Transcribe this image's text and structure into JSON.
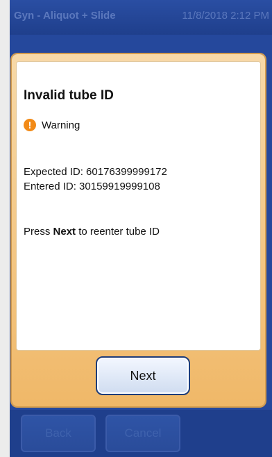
{
  "header": {
    "title": "Gyn - Aliquot + Slide",
    "datetime": "11/8/2018 2:12 PM"
  },
  "dialog": {
    "title": "Invalid tube ID",
    "severity_label": "Warning",
    "expected_label": "Expected ID: ",
    "expected_id": "60176399999172",
    "entered_label": "Entered ID: ",
    "entered_id": "30159919999108",
    "instruction_prefix": "Press ",
    "instruction_bold": "Next",
    "instruction_suffix": " to reenter tube ID",
    "next_label": "Next",
    "icon": "warning-icon",
    "warning_color": "#f28a17"
  },
  "nav": {
    "back_label": "Back",
    "cancel_label": "Cancel"
  }
}
